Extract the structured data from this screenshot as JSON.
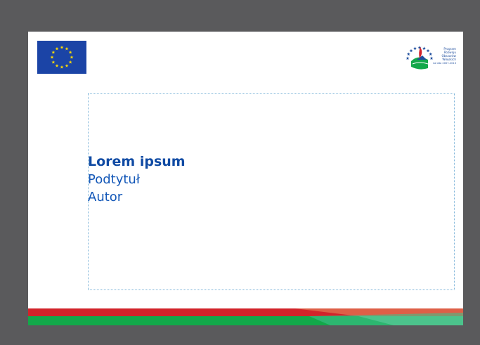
{
  "slide": {
    "title": "Lorem ipsum",
    "subtitle": "Podtytuł",
    "author": "Autor"
  },
  "logos": {
    "eu_flag_icon": "eu-flag-icon",
    "prow_logo_icon": "prow-logo-icon",
    "prow_text_lines": [
      "Program",
      "Rozwoju",
      "Obszarów",
      "Wiejskich",
      "na lata 2007-2013"
    ]
  },
  "colors": {
    "background": "#5a5a5c",
    "slide": "#ffffff",
    "eu_blue": "#1b44a6",
    "eu_gold": "#ffdd00",
    "title": "#0f4aa3",
    "text": "#1458b8",
    "stripe_red": "#d2232a",
    "stripe_green": "#13a84a"
  }
}
